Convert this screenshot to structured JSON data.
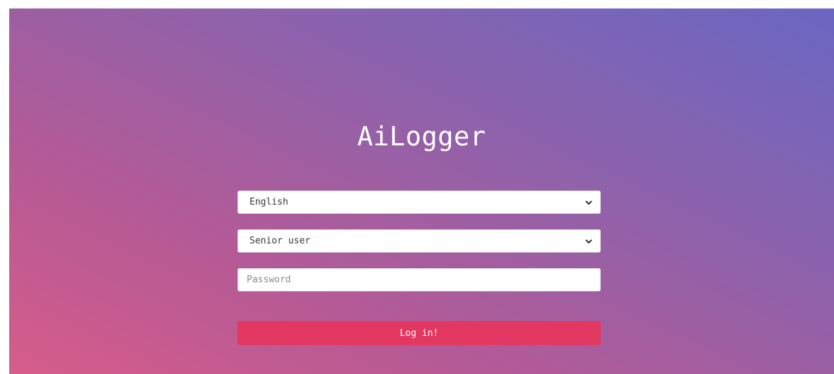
{
  "app": {
    "title": "AiLogger"
  },
  "form": {
    "language_select": {
      "selected": "English"
    },
    "user_select": {
      "selected": "Senior user"
    },
    "password": {
      "placeholder": "Password",
      "value": ""
    },
    "submit_label": "Log in!"
  },
  "icons": {
    "select_arrow": "chevron-down-icon"
  },
  "colors": {
    "gradient_start": "#d65c8a",
    "gradient_mid": "#8f62ab",
    "gradient_end": "#6a66c2",
    "button": "#e23761",
    "text_light": "#ffffff"
  }
}
